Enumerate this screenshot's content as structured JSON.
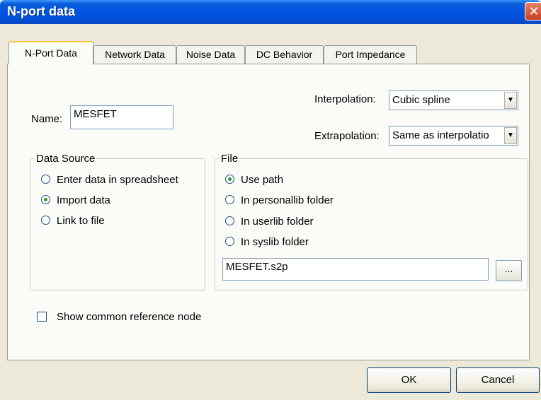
{
  "window": {
    "title": "N-port data",
    "close_icon": "close-icon"
  },
  "tabs": [
    {
      "label": "N-Port Data",
      "active": true
    },
    {
      "label": "Network Data",
      "active": false
    },
    {
      "label": "Noise Data",
      "active": false
    },
    {
      "label": "DC Behavior",
      "active": false
    },
    {
      "label": "Port Impedance",
      "active": false
    }
  ],
  "name_field": {
    "label": "Name:",
    "value": "MESFET"
  },
  "interpolation": {
    "label": "Interpolation:",
    "value": "Cubic spline"
  },
  "extrapolation": {
    "label": "Extrapolation:",
    "value": "Same as interpolatio"
  },
  "data_source": {
    "legend": "Data Source",
    "options": [
      {
        "label": "Enter data in spreadsheet",
        "checked": false
      },
      {
        "label": "Import data",
        "checked": true
      },
      {
        "label": "Link to file",
        "checked": false
      }
    ]
  },
  "file": {
    "legend": "File",
    "options": [
      {
        "label": "Use path",
        "checked": true
      },
      {
        "label": "In personallib folder",
        "checked": false
      },
      {
        "label": "In userlib folder",
        "checked": false
      },
      {
        "label": "In syslib folder",
        "checked": false
      }
    ],
    "path_value": "MESFET.s2p",
    "browse_label": "..."
  },
  "show_reference_node": {
    "label": "Show common reference node",
    "checked": false
  },
  "buttons": {
    "ok": "OK",
    "cancel": "Cancel"
  },
  "icons": {
    "dropdown": "chevron-down-icon"
  }
}
